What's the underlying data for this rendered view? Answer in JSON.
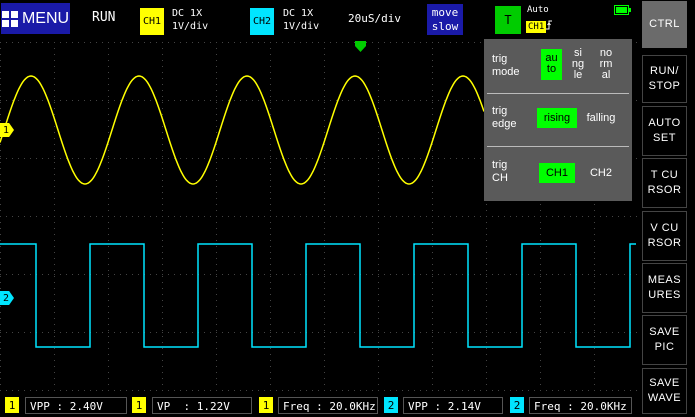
{
  "topbar": {
    "menu_label": "MENU",
    "run_state": "RUN",
    "ch1": {
      "tag": "CH1",
      "coupling": "DC  1X",
      "scale": "1V/div",
      "color": "#ffff00"
    },
    "ch2": {
      "tag": "CH2",
      "coupling": "DC  1X",
      "scale": "1V/div",
      "color": "#00e5ff"
    },
    "timebase": "20uS/div",
    "move_button": {
      "line1": "move",
      "line2": "slow"
    },
    "trigger": {
      "button": "T",
      "mode": "Auto",
      "source": "CH1",
      "edge_icon": "rising-edge-icon"
    },
    "battery_level": 1.0
  },
  "side_buttons": [
    {
      "id": "ctrl",
      "label": "CTRL"
    },
    {
      "id": "run-stop",
      "label": "RUN/\nSTOP"
    },
    {
      "id": "auto-set",
      "label": "AUTO\nSET"
    },
    {
      "id": "t-cursor",
      "label": "T CU\nRSOR"
    },
    {
      "id": "v-cursor",
      "label": "V CU\nRSOR"
    },
    {
      "id": "measures",
      "label": "MEAS\nURES"
    },
    {
      "id": "save-pic",
      "label": "SAVE\nPIC"
    },
    {
      "id": "save-wave",
      "label": "SAVE\nWAVE"
    }
  ],
  "trig_panel": {
    "mode": {
      "label": "trig\nmode",
      "options": [
        "au\nto",
        "si\nng\nle",
        "no\nrm\nal"
      ],
      "selected": 0
    },
    "edge": {
      "label": "trig\nedge",
      "options": [
        "rising",
        "falling"
      ],
      "selected": 0
    },
    "channel": {
      "label": "trig\nCH",
      "options": [
        "CH1",
        "CH2"
      ],
      "selected": 0
    }
  },
  "markers": {
    "ch1": "1",
    "ch2": "2"
  },
  "measurements": [
    {
      "ch": "1",
      "text": "VPP : 2.40V",
      "color": "#ffff00"
    },
    {
      "ch": "1",
      "text": "VP  : 1.22V",
      "color": "#ffff00"
    },
    {
      "ch": "1",
      "text": "Freq : 20.0KHz",
      "color": "#ffff00"
    },
    {
      "ch": "2",
      "text": "VPP : 2.14V",
      "color": "#00e5ff"
    },
    {
      "ch": "2",
      "text": "Freq : 20.0KHz",
      "color": "#00e5ff"
    }
  ],
  "colors": {
    "ch1": "#ffff00",
    "ch2": "#00e5ff",
    "trigger": "#00cc00",
    "menu": "#1a1aa8",
    "panel": "#5a5a5a"
  }
}
